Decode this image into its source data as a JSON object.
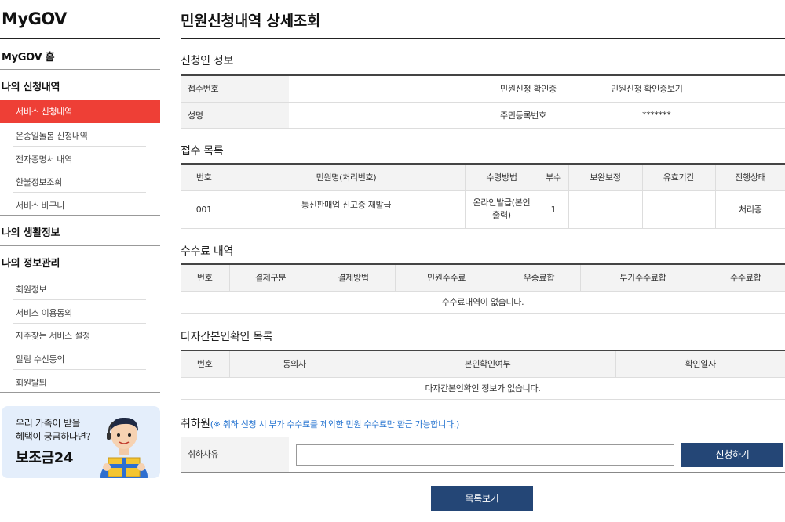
{
  "sidebar": {
    "logo": "MyGOV",
    "home": "MyGOV 홈",
    "section1": "나의 신청내역",
    "section1_items": [
      "서비스 신청내역",
      "온종일돌봄 신청내역",
      "전자증명서 내역",
      "환불정보조회",
      "서비스 바구니"
    ],
    "section2": "나의 생활정보",
    "section3": "나의 정보관리",
    "section3_items": [
      "회원정보",
      "서비스 이용동의",
      "자주찾는 서비스 설정",
      "알림 수신동의",
      "회원탈퇴"
    ],
    "banner": {
      "line1": "우리 가족이 받을",
      "line2": "혜택이 궁금하다면?",
      "brand": "보조금24"
    }
  },
  "main": {
    "title": "민원신청내역 상세조회",
    "applicant": {
      "title": "신청인 정보",
      "receipt_no_label": "접수번호",
      "receipt_no": "",
      "certificate_label": "민원신청 확인증",
      "certificate_link": "민원신청 확인증보기",
      "name_label": "성명",
      "name": "",
      "rrn_label": "주민등록번호",
      "rrn": "*******"
    },
    "receipts": {
      "title": "접수 목록",
      "headers": [
        "번호",
        "민원명(처리번호)",
        "수령방법",
        "부수",
        "보완보정",
        "유효기간",
        "진행상태"
      ],
      "rows": [
        [
          "001",
          "통신판매업 신고증 재발급",
          "온라인발급(본인출력)",
          "1",
          "",
          "",
          "처리중"
        ]
      ]
    },
    "fees": {
      "title": "수수료 내역",
      "headers": [
        "번호",
        "결제구분",
        "결제방법",
        "민원수수료",
        "우송료합",
        "부가수수료합",
        "수수료합"
      ],
      "empty": "수수료내역이 없습니다."
    },
    "multi_verify": {
      "title": "다자간본인확인 목록",
      "headers": [
        "번호",
        "동의자",
        "본인확인여부",
        "확인일자"
      ],
      "empty": "다자간본인확인 정보가 없습니다."
    },
    "cancel": {
      "title": "취하원",
      "note": "(※ 취하 신청 시 부가 수수료를 제외한 민원 수수료만 환급 가능합니다.)",
      "reason_label": "취하사유",
      "reason_value": "",
      "apply_button": "신청하기"
    },
    "list_button": "목록보기"
  },
  "colors": {
    "active": "#ee3f36",
    "navy": "#244676",
    "note": "#2473d0"
  }
}
